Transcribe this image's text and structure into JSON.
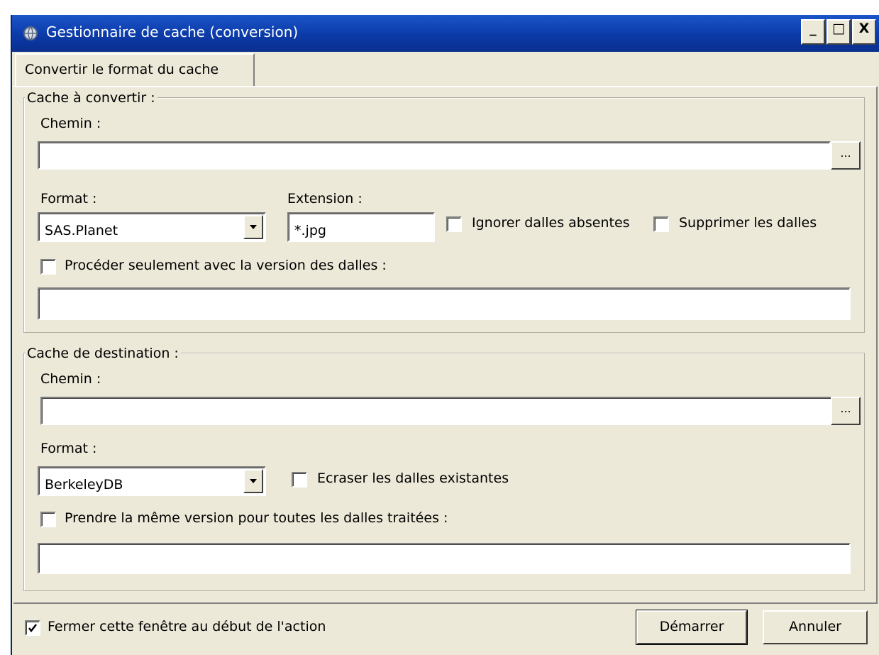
{
  "window": {
    "title": "Gestionnaire de cache (conversion)",
    "controls": {
      "minimize": "_",
      "maximize": "□",
      "close": "X"
    }
  },
  "tab": {
    "label": "Convertir le format du cache"
  },
  "source": {
    "legend": "Cache à convertir :",
    "path_label": "Chemin :",
    "path_value": "",
    "browse_label": "...",
    "format_label": "Format :",
    "format_value": "SAS.Planet",
    "extension_label": "Extension :",
    "extension_value": "*.jpg",
    "ignore_missing": {
      "label": "Ignorer dalles absentes",
      "checked": false
    },
    "delete_tiles": {
      "label": "Supprimer les dalles",
      "checked": false
    },
    "version_only": {
      "label": "Procéder seulement avec la version des dalles :",
      "checked": false
    },
    "version_value": ""
  },
  "destination": {
    "legend": "Cache de destination :",
    "path_label": "Chemin :",
    "path_value": "",
    "browse_label": "...",
    "format_label": "Format :",
    "format_value": "BerkeleyDB",
    "overwrite": {
      "label": "Ecraser les dalles existantes",
      "checked": false
    },
    "same_version": {
      "label": "Prendre la même version pour toutes les dalles traitées :",
      "checked": false
    },
    "version_value": ""
  },
  "footer": {
    "close_on_start": {
      "label": "Fermer cette fenêtre au début de l'action",
      "checked": true
    },
    "start_label": "Démarrer",
    "cancel_label": "Annuler"
  }
}
